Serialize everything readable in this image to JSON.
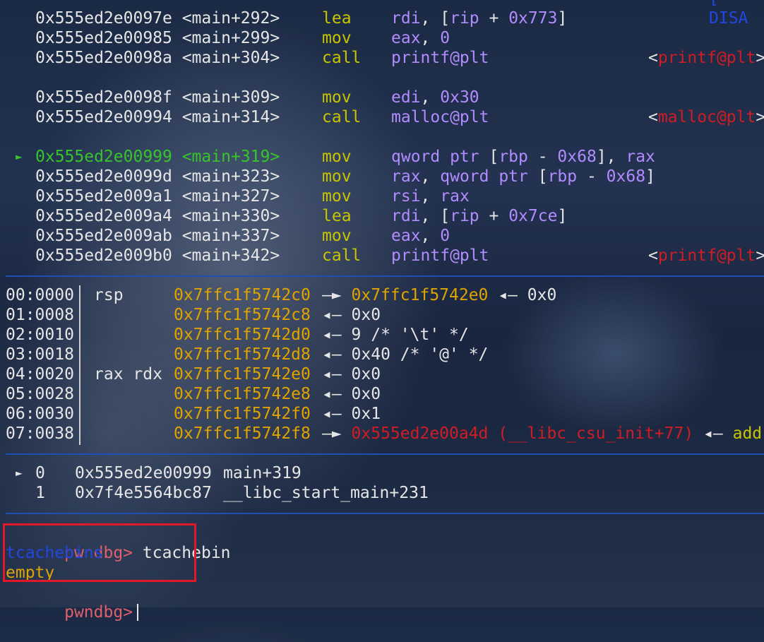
{
  "corner_label": "[ DISA",
  "disasm": [
    {
      "addr": "0x555ed2e0097e",
      "sym": "<main+292>",
      "mn": "lea",
      "ops": [
        [
          "rdi",
          "c-purple"
        ],
        [
          ", [",
          "c-white"
        ],
        [
          "rip",
          "c-purple"
        ],
        [
          " + ",
          "c-white"
        ],
        [
          "0x773",
          "c-purple"
        ],
        [
          "]",
          "c-white"
        ]
      ],
      "target": "",
      "current": false
    },
    {
      "addr": "0x555ed2e00985",
      "sym": "<main+299>",
      "mn": "mov",
      "ops": [
        [
          "eax",
          "c-purple"
        ],
        [
          ", ",
          "c-white"
        ],
        [
          "0",
          "c-purple"
        ]
      ],
      "target": "",
      "current": false
    },
    {
      "addr": "0x555ed2e0098a",
      "sym": "<main+304>",
      "mn": "call",
      "ops": [
        [
          "printf@plt",
          "c-purple"
        ]
      ],
      "target": "printf@plt",
      "current": false
    },
    {
      "addr": "0x555ed2e0098f",
      "sym": "<main+309>",
      "mn": "mov",
      "ops": [
        [
          "edi",
          "c-purple"
        ],
        [
          ", ",
          "c-white"
        ],
        [
          "0x30",
          "c-purple"
        ]
      ],
      "target": "",
      "current": false
    },
    {
      "addr": "0x555ed2e00994",
      "sym": "<main+314>",
      "mn": "call",
      "ops": [
        [
          "malloc@plt",
          "c-purple"
        ]
      ],
      "target": "malloc@plt",
      "current": false
    },
    {
      "addr": "0x555ed2e00999",
      "sym": "<main+319>",
      "mn": "mov",
      "ops": [
        [
          "qword ptr",
          "c-purple"
        ],
        [
          " [",
          "c-white"
        ],
        [
          "rbp",
          "c-purple"
        ],
        [
          " - ",
          "c-white"
        ],
        [
          "0x68",
          "c-purple"
        ],
        [
          "], ",
          "c-white"
        ],
        [
          "rax",
          "c-purple"
        ]
      ],
      "target": "",
      "current": true
    },
    {
      "addr": "0x555ed2e0099d",
      "sym": "<main+323>",
      "mn": "mov",
      "ops": [
        [
          "rax",
          "c-purple"
        ],
        [
          ", ",
          "c-white"
        ],
        [
          "qword ptr",
          "c-purple"
        ],
        [
          " [",
          "c-white"
        ],
        [
          "rbp",
          "c-purple"
        ],
        [
          " - ",
          "c-white"
        ],
        [
          "0x68",
          "c-purple"
        ],
        [
          "]",
          "c-white"
        ]
      ],
      "target": "",
      "current": false
    },
    {
      "addr": "0x555ed2e009a1",
      "sym": "<main+327>",
      "mn": "mov",
      "ops": [
        [
          "rsi",
          "c-purple"
        ],
        [
          ", ",
          "c-white"
        ],
        [
          "rax",
          "c-purple"
        ]
      ],
      "target": "",
      "current": false
    },
    {
      "addr": "0x555ed2e009a4",
      "sym": "<main+330>",
      "mn": "lea",
      "ops": [
        [
          "rdi",
          "c-purple"
        ],
        [
          ", [",
          "c-white"
        ],
        [
          "rip",
          "c-purple"
        ],
        [
          " + ",
          "c-white"
        ],
        [
          "0x7ce",
          "c-purple"
        ],
        [
          "]",
          "c-white"
        ]
      ],
      "target": "",
      "current": false
    },
    {
      "addr": "0x555ed2e009ab",
      "sym": "<main+337>",
      "mn": "mov",
      "ops": [
        [
          "eax",
          "c-purple"
        ],
        [
          ", ",
          "c-white"
        ],
        [
          "0",
          "c-purple"
        ]
      ],
      "target": "",
      "current": false
    },
    {
      "addr": "0x555ed2e009b0",
      "sym": "<main+342>",
      "mn": "call",
      "ops": [
        [
          "printf@plt",
          "c-purple"
        ]
      ],
      "target": "printf@plt",
      "current": false
    }
  ],
  "current_marker": "►",
  "stack": [
    {
      "idx": "00:0000",
      "reg": "rsp",
      "addr": "0x7ffc1f5742c0",
      "rest": [
        [
          "—► ",
          "c-white"
        ],
        [
          "0x7ffc1f5742e0",
          "c-orange"
        ],
        [
          " ◂— 0x0",
          "c-white"
        ]
      ]
    },
    {
      "idx": "01:0008",
      "reg": "",
      "addr": "0x7ffc1f5742c8",
      "rest": [
        [
          "◂— 0x0",
          "c-white"
        ]
      ]
    },
    {
      "idx": "02:0010",
      "reg": "",
      "addr": "0x7ffc1f5742d0",
      "rest": [
        [
          "◂— 9 /* '\\t' */",
          "c-white"
        ]
      ]
    },
    {
      "idx": "03:0018",
      "reg": "",
      "addr": "0x7ffc1f5742d8",
      "rest": [
        [
          "◂— 0x40 /* '@' */",
          "c-white"
        ]
      ]
    },
    {
      "idx": "04:0020",
      "reg": "rax rdx",
      "addr": "0x7ffc1f5742e0",
      "rest": [
        [
          "◂— 0x0",
          "c-white"
        ]
      ]
    },
    {
      "idx": "05:0028",
      "reg": "",
      "addr": "0x7ffc1f5742e8",
      "rest": [
        [
          "◂— 0x0",
          "c-white"
        ]
      ]
    },
    {
      "idx": "06:0030",
      "reg": "",
      "addr": "0x7ffc1f5742f0",
      "rest": [
        [
          "◂— 0x1",
          "c-white"
        ]
      ]
    },
    {
      "idx": "07:0038",
      "reg": "",
      "addr": "0x7ffc1f5742f8",
      "rest": [
        [
          "—► ",
          "c-white"
        ],
        [
          "0x555ed2e00a4d (__libc_csu_init+77)",
          "c-red"
        ],
        [
          " ◂— ",
          "c-white"
        ],
        [
          "add",
          "c-yellow"
        ]
      ]
    }
  ],
  "backtrace": [
    {
      "marker": "►",
      "idx": "0",
      "addr": "0x555ed2e00999",
      "sym": "main+319"
    },
    {
      "marker": "",
      "idx": "1",
      "addr": "0x7f4e5564bc87",
      "sym": "__libc_start_main+231"
    }
  ],
  "console": {
    "prompt": "pwndbg>",
    "command": "tcachebin",
    "header": "tcachebins",
    "result": "empty",
    "prompt2": "pwndbg>"
  }
}
